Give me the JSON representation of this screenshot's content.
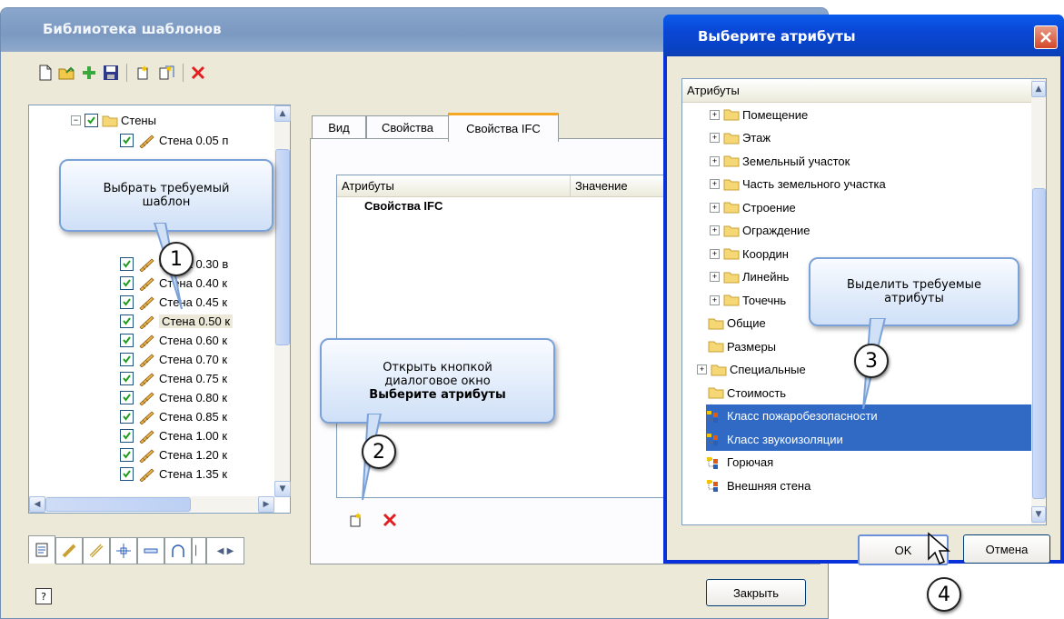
{
  "main_window": {
    "title": "Библиотека шаблонов",
    "toolbar": [
      "new-icon",
      "open-icon",
      "add-icon",
      "save-icon",
      "new-template-icon",
      "copy-template-icon",
      "delete-icon"
    ],
    "tree": {
      "root_label": "Стены",
      "items": [
        "Стена 0.05 п",
        "Стена 0.30 в",
        "Стена 0.40 к",
        "Стена 0.45 к",
        "Стена 0.50 к",
        "Стена 0.60 к",
        "Стена 0.70 к",
        "Стена 0.75 к",
        "Стена 0.80 к",
        "Стена 0.85 к",
        "Стена 1.00 к",
        "Стена 1.20 к",
        "Стена 1.35 к"
      ],
      "selected": "Стена 0.50 к"
    },
    "tabs": [
      "Вид",
      "Свойства",
      "Свойства IFC"
    ],
    "active_tab": "Свойства IFC",
    "attr_table": {
      "columns": [
        "Атрибуты",
        "Значение"
      ],
      "group_row": "Свойства IFC"
    },
    "close_button": "Закрыть"
  },
  "dialog": {
    "title": "Выберите атрибуты",
    "tree_header": "Атрибуты",
    "folders_expandable": [
      "Помещение",
      "Этаж",
      "Земельный участок",
      "Часть земельного участка",
      "Строение",
      "Ограждение",
      "Координ",
      "Линейнь",
      "Точечнь"
    ],
    "folders_plain": [
      "Общие",
      "Размеры"
    ],
    "folder_special": "Специальные",
    "folder_cost": "Стоимость",
    "attributes": [
      {
        "label": "Класс пожаробезопасности",
        "selected": true
      },
      {
        "label": "Класс звукоизоляции",
        "selected": true
      },
      {
        "label": "Горючая",
        "selected": false
      },
      {
        "label": "Внешняя стена",
        "selected": false
      }
    ],
    "ok_button": "OK",
    "cancel_button": "Отмена"
  },
  "callouts": {
    "c1": [
      "Выбрать требуемый",
      "шаблон"
    ],
    "c2": [
      "Открыть кнопкой",
      "диалоговое окно",
      "Выберите атрибуты"
    ],
    "c3": [
      "Выделить требуемые",
      "атрибуты"
    ]
  },
  "steps": [
    "1",
    "2",
    "3",
    "4"
  ],
  "colors": {
    "selection": "#316ac5",
    "dialog_title": "#0a47d6",
    "callout_border": "#7aa2d8"
  }
}
